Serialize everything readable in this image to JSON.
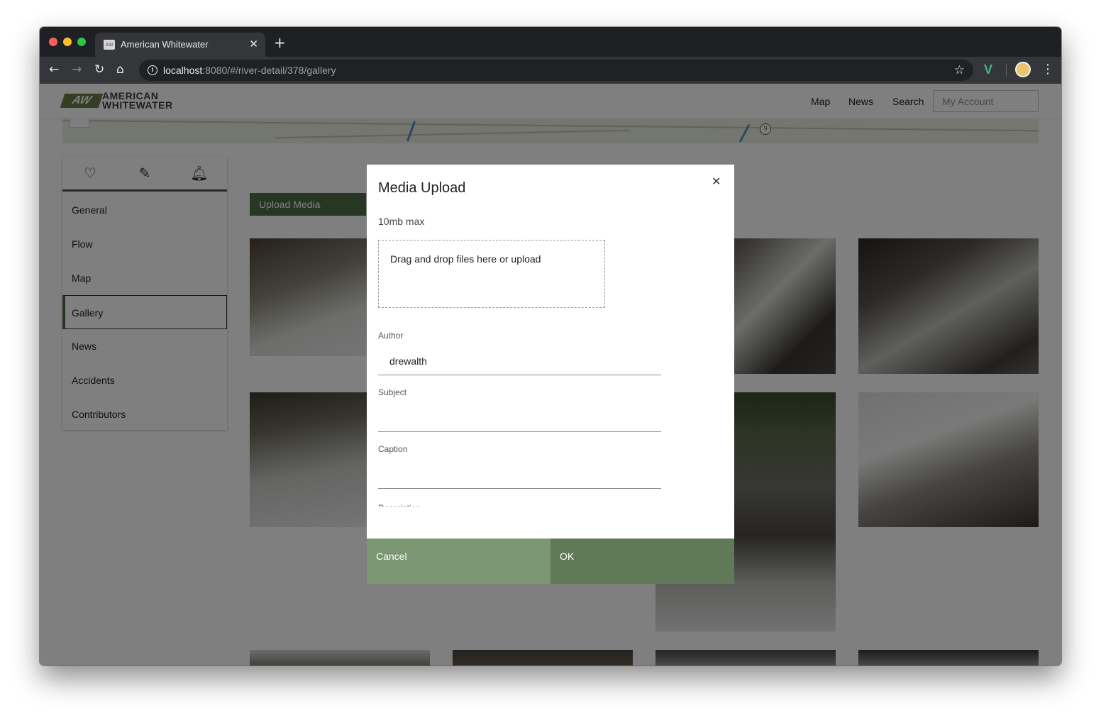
{
  "browser": {
    "tab_title": "American Whitewater",
    "tab_favicon_text": "AW",
    "url_host": "localhost",
    "url_path": ":8080/#/river-detail/378/gallery"
  },
  "site": {
    "logo_mark": "AW",
    "logo_line1": "AMERICAN",
    "logo_line2": "WHITEWATER",
    "nav": {
      "map": "Map",
      "news": "News",
      "search": "Search"
    },
    "account_placeholder": "My Account"
  },
  "sidebar": {
    "items": [
      {
        "label": "General"
      },
      {
        "label": "Flow"
      },
      {
        "label": "Map"
      },
      {
        "label": "Gallery",
        "active": true
      },
      {
        "label": "News"
      },
      {
        "label": "Accidents"
      },
      {
        "label": "Contributors"
      }
    ]
  },
  "gallery": {
    "upload_label": "Upload Media"
  },
  "modal": {
    "title": "Media Upload",
    "max_note": "10mb max",
    "dropzone_text": "Drag and drop files here or upload",
    "fields": {
      "author_label": "Author",
      "author_value": "drewalth",
      "subject_label": "Subject",
      "subject_value": "",
      "caption_label": "Caption",
      "caption_value": "",
      "description_label": "Description"
    },
    "cancel_label": "Cancel",
    "ok_label": "OK"
  },
  "colors": {
    "brand_green": "#4f6f47",
    "cancel_bg": "#7a9672",
    "ok_bg": "#607a58"
  }
}
